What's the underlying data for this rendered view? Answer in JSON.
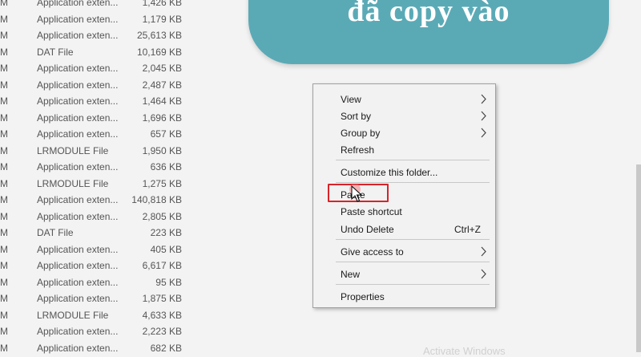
{
  "file_list": [
    {
      "date": "M",
      "type": "Application exten...",
      "size": "1,426 KB"
    },
    {
      "date": "M",
      "type": "Application exten...",
      "size": "1,179 KB"
    },
    {
      "date": "M",
      "type": "Application exten...",
      "size": "25,613 KB"
    },
    {
      "date": "M",
      "type": "DAT File",
      "size": "10,169 KB"
    },
    {
      "date": "M",
      "type": "Application exten...",
      "size": "2,045 KB"
    },
    {
      "date": "M",
      "type": "Application exten...",
      "size": "2,487 KB"
    },
    {
      "date": "M",
      "type": "Application exten...",
      "size": "1,464 KB"
    },
    {
      "date": "M",
      "type": "Application exten...",
      "size": "1,696 KB"
    },
    {
      "date": "M",
      "type": "Application exten...",
      "size": "657 KB"
    },
    {
      "date": "M",
      "type": "LRMODULE File",
      "size": "1,950 KB"
    },
    {
      "date": "M",
      "type": "Application exten...",
      "size": "636 KB"
    },
    {
      "date": "M",
      "type": "LRMODULE File",
      "size": "1,275 KB"
    },
    {
      "date": "M",
      "type": "Application exten...",
      "size": "140,818 KB"
    },
    {
      "date": "M",
      "type": "Application exten...",
      "size": "2,805 KB"
    },
    {
      "date": "M",
      "type": "DAT File",
      "size": "223 KB"
    },
    {
      "date": "M",
      "type": "Application exten...",
      "size": "405 KB"
    },
    {
      "date": "M",
      "type": "Application exten...",
      "size": "6,617 KB"
    },
    {
      "date": "M",
      "type": "Application exten...",
      "size": "95 KB"
    },
    {
      "date": "M",
      "type": "Application exten...",
      "size": "1,875 KB"
    },
    {
      "date": "M",
      "type": "LRMODULE File",
      "size": "4,633 KB"
    },
    {
      "date": "M",
      "type": "Application exten...",
      "size": "2,223 KB"
    },
    {
      "date": "M",
      "type": "Application exten...",
      "size": "682 KB"
    }
  ],
  "banner": {
    "text": "đã copy vào",
    "color": "#5aaab6"
  },
  "context_menu": {
    "view": "View",
    "sort_by": "Sort by",
    "group_by": "Group by",
    "refresh": "Refresh",
    "customize": "Customize this folder...",
    "paste": "Paste",
    "paste_shortcut": "Paste shortcut",
    "undo_delete": "Undo Delete",
    "undo_delete_shortcut": "Ctrl+Z",
    "give_access": "Give access to",
    "new": "New",
    "properties": "Properties"
  },
  "highlight_color": "#d9232a",
  "watermark": "Activate Windows"
}
